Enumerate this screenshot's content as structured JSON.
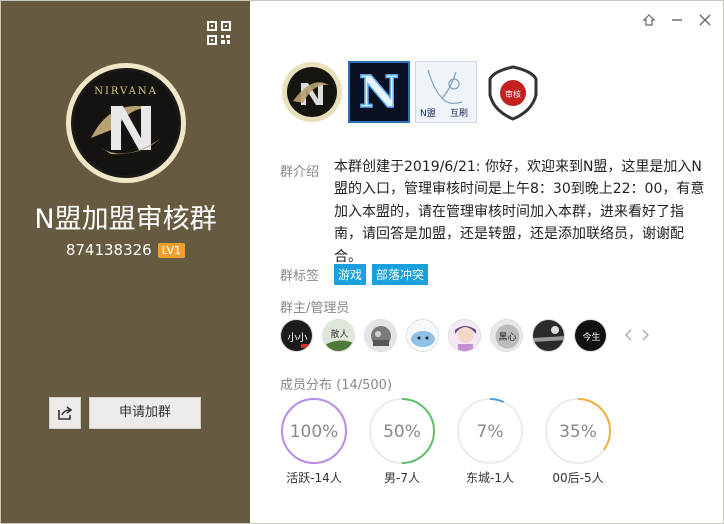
{
  "group": {
    "name": "N盟加盟审核群",
    "id": "874138326",
    "level": "LV1",
    "avatar_text": "NIRVANA"
  },
  "actions": {
    "join_label": "申请加群"
  },
  "logos": {
    "l2": "N",
    "l3": "N盟",
    "l3_b": "互刷",
    "l4": "审核"
  },
  "intro": {
    "label": "群介绍",
    "text": "本群创建于2019/6/21: 你好，欢迎来到N盟，这里是加入N盟的入口，管理审核时间是上午8：30到晚上22：00，有意加入本盟的，请在管理审核时间加入本群，进来看好了指南，请回答是加盟，还是转盟，还是添加联络员，谢谢配合。"
  },
  "tags": {
    "label": "群标签",
    "items": [
      "游戏",
      "部落冲突"
    ]
  },
  "admins": {
    "label": "群主/管理员",
    "a1": "小小",
    "a2": "散人",
    "a6": "黑心",
    "a8": "今生"
  },
  "members": {
    "label": "成员分布 (14/500)",
    "stats": [
      {
        "value": "100%",
        "label": "活跃-14人",
        "fraction": 1.0,
        "color": "#b88de8"
      },
      {
        "value": "50%",
        "label": "男-7人",
        "fraction": 0.5,
        "color": "#5ec06c"
      },
      {
        "value": "7%",
        "label": "东城-1人",
        "fraction": 0.07,
        "color": "#4a9ee0"
      },
      {
        "value": "35%",
        "label": "00后-5人",
        "fraction": 0.35,
        "color": "#f0b040"
      }
    ]
  },
  "colors": {
    "left_panel": "#665a40",
    "tag_blue": "#1aa0dc",
    "level_badge": "#f0a030"
  }
}
